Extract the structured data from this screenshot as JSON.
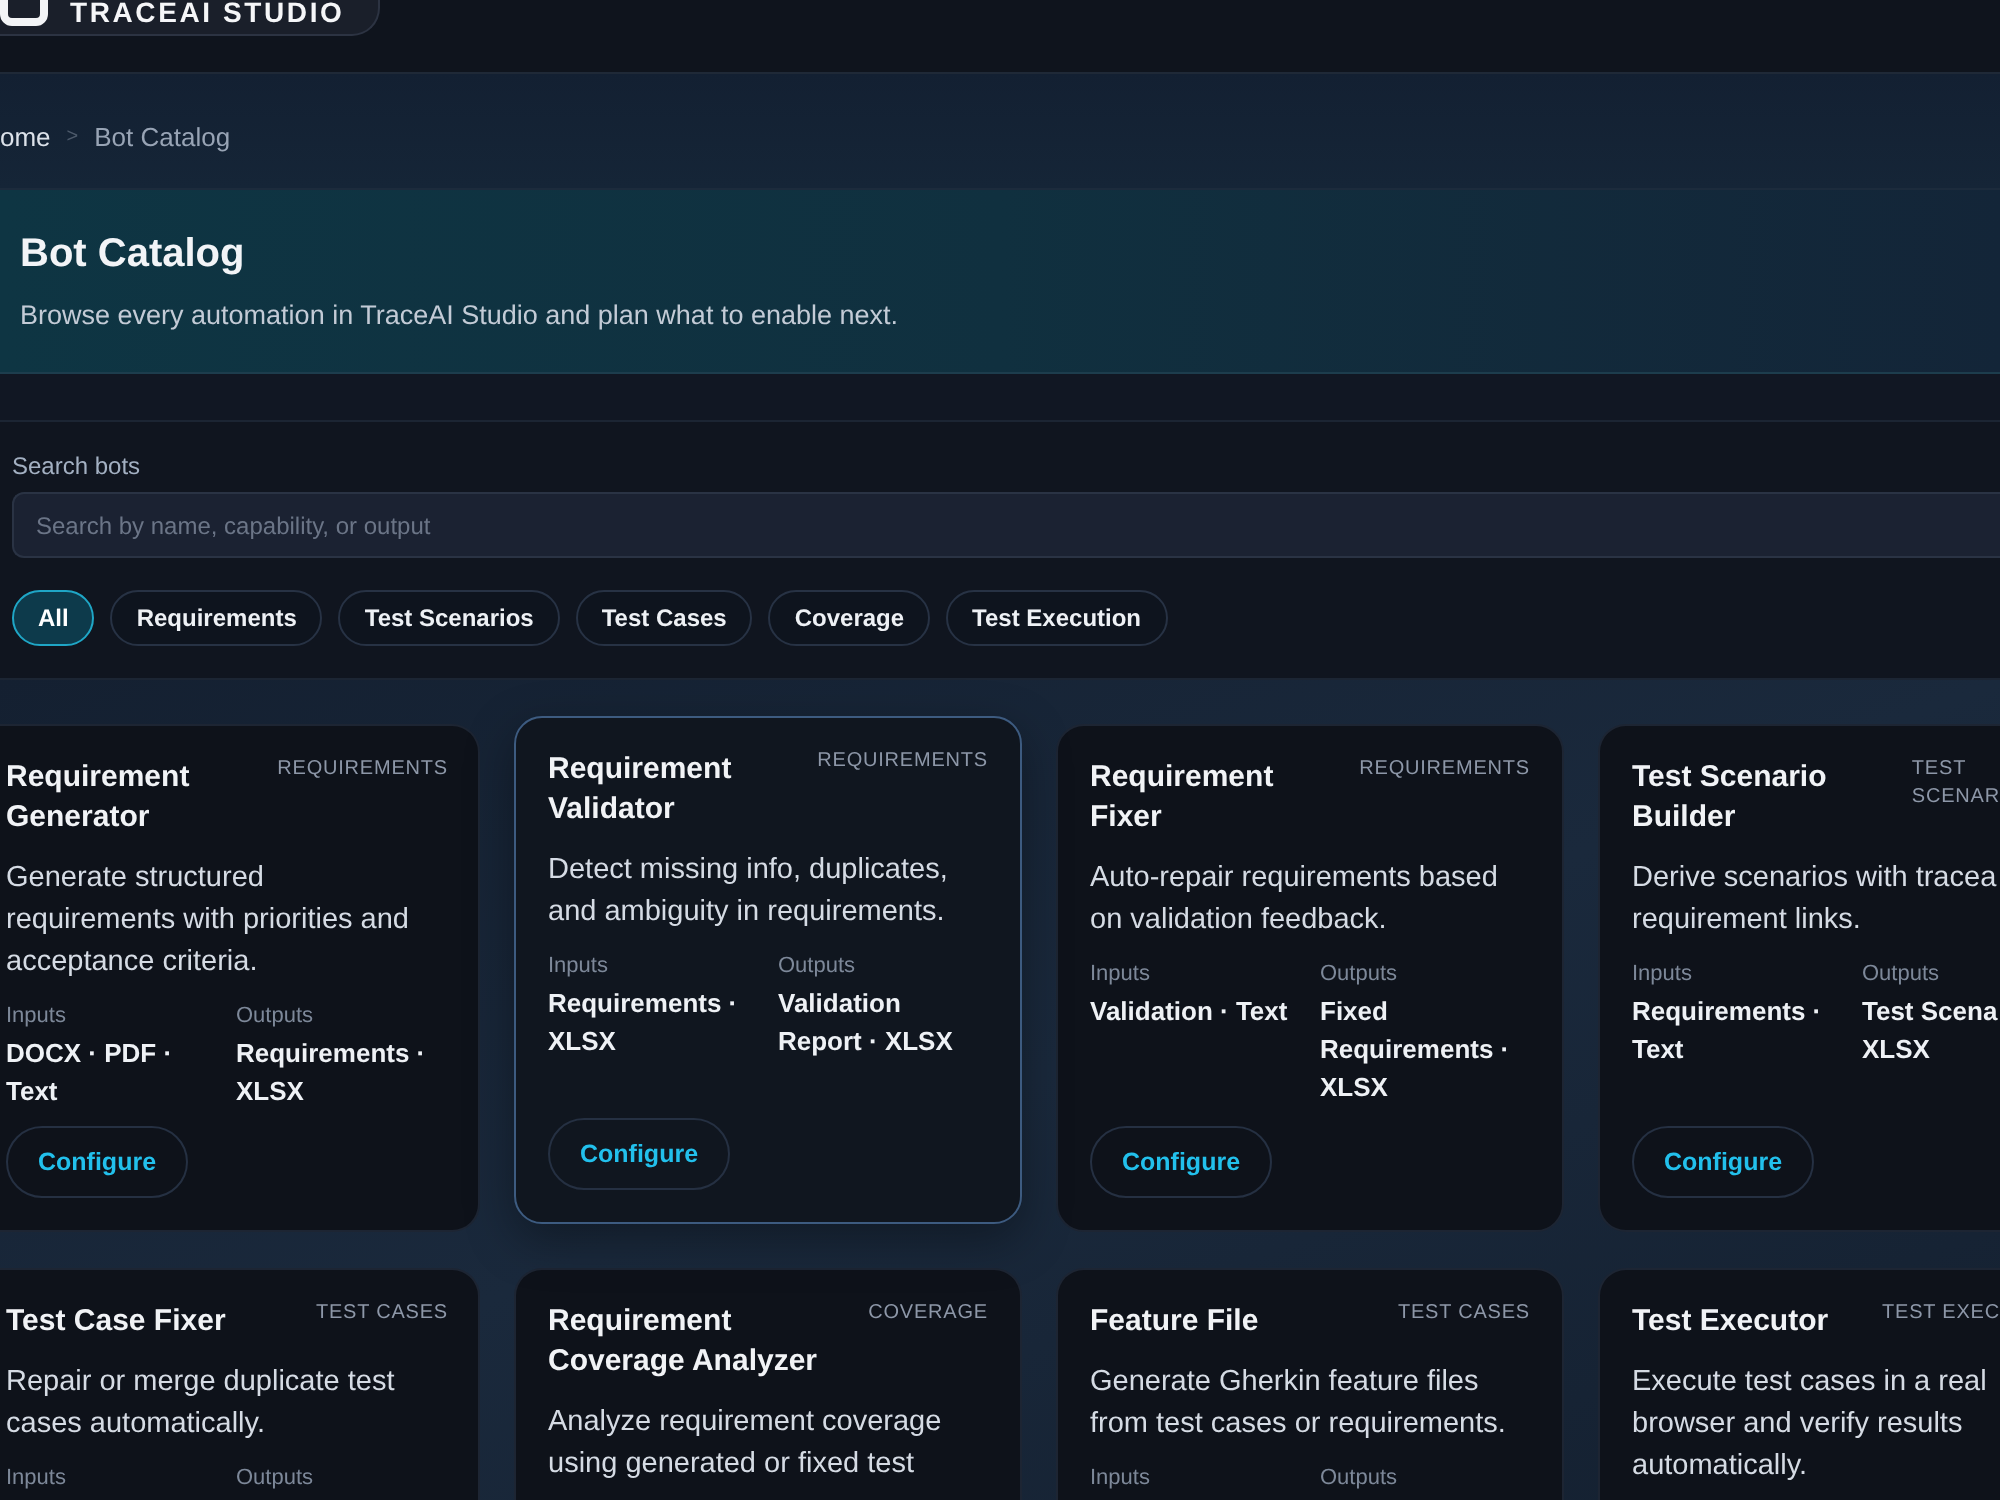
{
  "header": {
    "logo_text": "TRACEAI STUDIO"
  },
  "breadcrumb": {
    "separator": ">",
    "items": [
      {
        "label": "ome",
        "current": false
      },
      {
        "label": "Bot Catalog",
        "current": true
      }
    ]
  },
  "hero": {
    "title": "Bot Catalog",
    "subtitle": "Browse every automation in TraceAI Studio and plan what to enable next."
  },
  "search": {
    "label": "Search bots",
    "placeholder": "Search by name, capability, or output"
  },
  "filters": [
    {
      "label": "All",
      "selected": true
    },
    {
      "label": "Requirements",
      "selected": false
    },
    {
      "label": "Test Scenarios",
      "selected": false
    },
    {
      "label": "Test Cases",
      "selected": false
    },
    {
      "label": "Coverage",
      "selected": false
    },
    {
      "label": "Test Execution",
      "selected": false
    }
  ],
  "cards": [
    {
      "title": "Requirement\nGenerator",
      "tag": "REQUIREMENTS",
      "description": "Generate structured\nrequirements with priorities and\nacceptance criteria.",
      "highlighted": false,
      "inputs": {
        "label": "Inputs",
        "value": "DOCX · PDF ·\nText"
      },
      "outputs": {
        "label": "Outputs",
        "value": "Requirements ·\nXLSX"
      },
      "button": "Configure"
    },
    {
      "title": "Requirement\nValidator",
      "tag": "REQUIREMENTS",
      "description": "Detect missing info, duplicates,\nand ambiguity in requirements.",
      "highlighted": true,
      "inputs": {
        "label": "Inputs",
        "value": "Requirements ·\nXLSX"
      },
      "outputs": {
        "label": "Outputs",
        "value": "Validation\nReport · XLSX"
      },
      "button": "Configure"
    },
    {
      "title": "Requirement\nFixer",
      "tag": "REQUIREMENTS",
      "description": "Auto-repair requirements based\non validation feedback.",
      "highlighted": false,
      "inputs": {
        "label": "Inputs",
        "value": "Validation · Text"
      },
      "outputs": {
        "label": "Outputs",
        "value": "Fixed\nRequirements ·\nXLSX"
      },
      "button": "Configure"
    },
    {
      "title": "Test Scenario\nBuilder",
      "tag": "TEST\nSCENAR",
      "description": "Derive scenarios with tracea\nrequirement links.",
      "highlighted": false,
      "inputs": {
        "label": "Inputs",
        "value": "Requirements ·\nText"
      },
      "outputs": {
        "label": "Outputs",
        "value": "Test Scena\nXLSX"
      },
      "button": "Configure"
    },
    {
      "title": "Test Case Fixer",
      "tag": "TEST CASES",
      "description": "Repair or merge duplicate test\ncases automatically.",
      "highlighted": false,
      "inputs": {
        "label": "Inputs"
      },
      "outputs": {
        "label": "Outputs"
      }
    },
    {
      "title": "Requirement\nCoverage Analyzer",
      "tag": "COVERAGE",
      "description": "Analyze requirement coverage\nusing generated or fixed test",
      "highlighted": false
    },
    {
      "title": "Feature File",
      "tag": "TEST CASES",
      "description": "Generate Gherkin feature files\nfrom test cases or requirements.",
      "highlighted": false,
      "inputs": {
        "label": "Inputs"
      },
      "outputs": {
        "label": "Outputs"
      }
    },
    {
      "title": "Test Executor",
      "tag": "TEST EXEC",
      "description": "Execute test cases in a real\nbrowser and verify results\nautomatically.",
      "highlighted": false
    }
  ]
}
